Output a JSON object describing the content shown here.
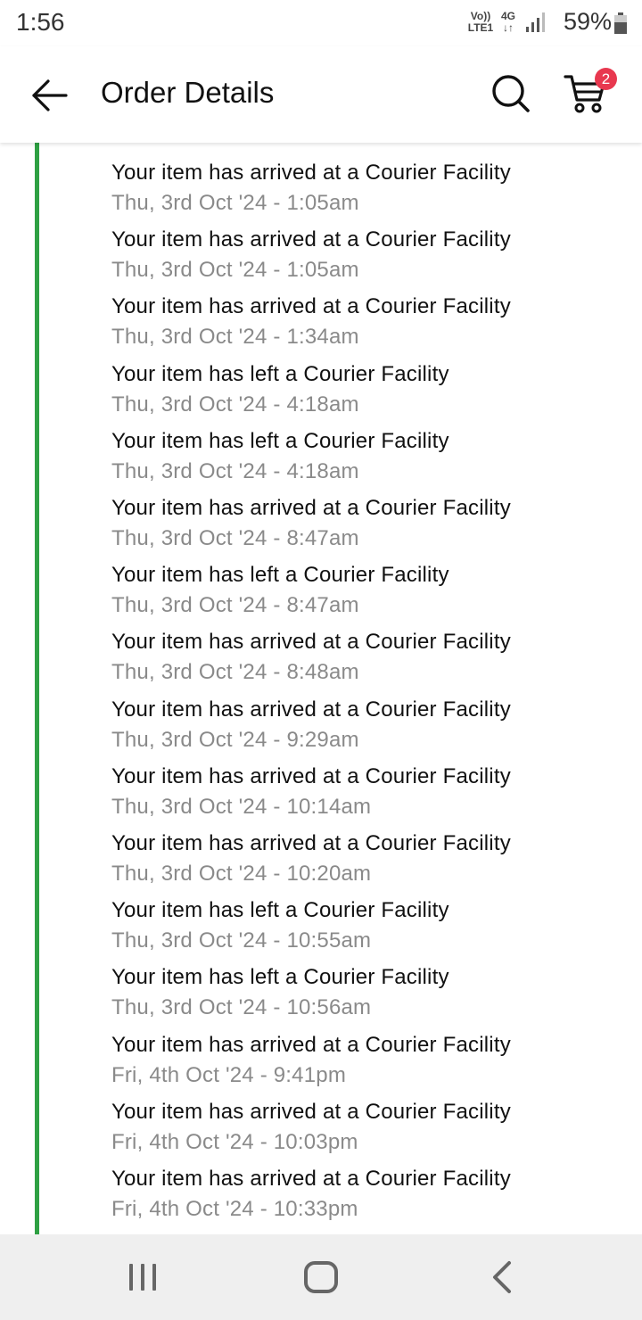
{
  "status_bar": {
    "time": "1:56",
    "network_top": "Vo))",
    "network_bottom": "LTE1",
    "data_type": "4G",
    "battery_percent": "59%"
  },
  "header": {
    "title": "Order Details",
    "cart_count": "2",
    "icons": [
      "back-arrow-icon",
      "search-icon",
      "cart-icon"
    ]
  },
  "colors": {
    "timeline_accent": "#2ea043",
    "badge": "#e8384f",
    "timestamp_text": "#8a8a8a"
  },
  "timeline": {
    "events": [
      {
        "title": "Your item has arrived at a Courier Facility",
        "time": "Thu, 3rd Oct '24 - 1:05am"
      },
      {
        "title": "Your item has arrived at a Courier Facility",
        "time": "Thu, 3rd Oct '24 - 1:05am"
      },
      {
        "title": "Your item has arrived at a Courier Facility",
        "time": "Thu, 3rd Oct '24 - 1:34am"
      },
      {
        "title": "Your item has left a Courier Facility",
        "time": "Thu, 3rd Oct '24 - 4:18am"
      },
      {
        "title": "Your item has left a Courier Facility",
        "time": "Thu, 3rd Oct '24 - 4:18am"
      },
      {
        "title": "Your item has arrived at a Courier Facility",
        "time": "Thu, 3rd Oct '24 - 8:47am"
      },
      {
        "title": "Your item has left a Courier Facility",
        "time": "Thu, 3rd Oct '24 - 8:47am"
      },
      {
        "title": "Your item has arrived at a Courier Facility",
        "time": "Thu, 3rd Oct '24 - 8:48am"
      },
      {
        "title": "Your item has arrived at a Courier Facility",
        "time": "Thu, 3rd Oct '24 - 9:29am"
      },
      {
        "title": "Your item has arrived at a Courier Facility",
        "time": "Thu, 3rd Oct '24 - 10:14am"
      },
      {
        "title": "Your item has arrived at a Courier Facility",
        "time": "Thu, 3rd Oct '24 - 10:20am"
      },
      {
        "title": "Your item has left a Courier Facility",
        "time": "Thu, 3rd Oct '24 - 10:55am"
      },
      {
        "title": "Your item has left a Courier Facility",
        "time": "Thu, 3rd Oct '24 - 10:56am"
      },
      {
        "title": "Your item has arrived at a Courier Facility",
        "time": "Fri, 4th Oct '24 - 9:41pm"
      },
      {
        "title": "Your item has arrived at a Courier Facility",
        "time": "Fri, 4th Oct '24 - 10:03pm"
      },
      {
        "title": "Your item has arrived at a Courier Facility",
        "time": "Fri, 4th Oct '24 - 10:33pm"
      }
    ]
  },
  "nav_bar": {
    "icons": [
      "recents-icon",
      "home-icon",
      "back-icon"
    ]
  }
}
